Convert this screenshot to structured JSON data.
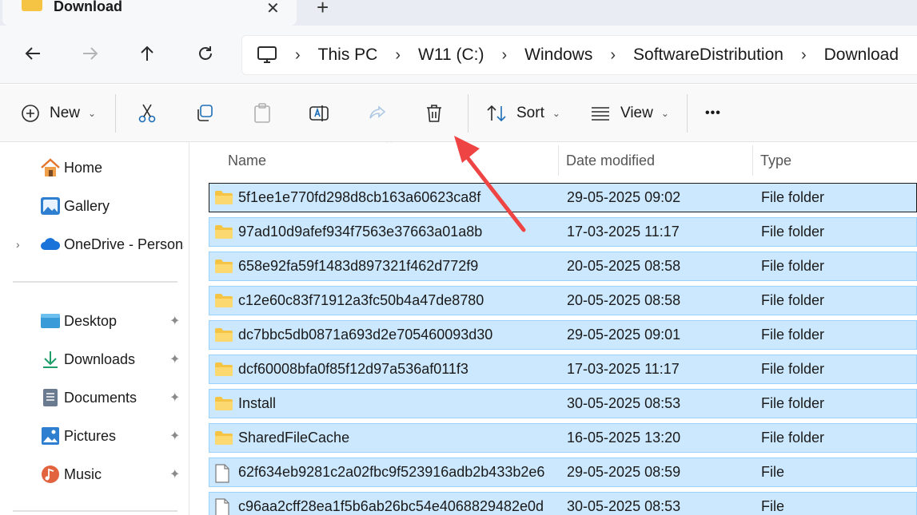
{
  "tab": {
    "title": "Download",
    "close_glyph": "✕",
    "new_glyph": "+"
  },
  "nav": {
    "back_icon": "arrow-left-icon",
    "forward_icon": "arrow-right-icon",
    "up_icon": "arrow-up-icon",
    "refresh_icon": "refresh-icon"
  },
  "breadcrumb": [
    "This PC",
    "W11 (C:)",
    "Windows",
    "SoftwareDistribution",
    "Download"
  ],
  "toolbar": {
    "new_label": "New",
    "sort_label": "Sort",
    "view_label": "View",
    "more_glyph": "•••"
  },
  "sidebar": {
    "top": [
      {
        "label": "Home",
        "icon": "home-icon"
      },
      {
        "label": "Gallery",
        "icon": "gallery-icon"
      },
      {
        "label": "OneDrive - Persona",
        "icon": "cloud-icon"
      }
    ],
    "quick": [
      {
        "label": "Desktop",
        "icon": "desktop-icon"
      },
      {
        "label": "Downloads",
        "icon": "download-icon"
      },
      {
        "label": "Documents",
        "icon": "documents-icon"
      },
      {
        "label": "Pictures",
        "icon": "pictures-icon"
      },
      {
        "label": "Music",
        "icon": "music-icon"
      }
    ],
    "expander_glyph": "›",
    "pin_glyph": "📌"
  },
  "columns": {
    "name": "Name",
    "date": "Date modified",
    "type": "Type"
  },
  "rows": [
    {
      "name": "5f1ee1e770fd298d8cb163a60623ca8f",
      "date": "29-05-2025 09:02",
      "type": "File folder",
      "kind": "folder"
    },
    {
      "name": "97ad10d9afef934f7563e37663a01a8b",
      "date": "17-03-2025 11:17",
      "type": "File folder",
      "kind": "folder"
    },
    {
      "name": "658e92fa59f1483d897321f462d772f9",
      "date": "20-05-2025 08:58",
      "type": "File folder",
      "kind": "folder"
    },
    {
      "name": "c12e60c83f71912a3fc50b4a47de8780",
      "date": "20-05-2025 08:58",
      "type": "File folder",
      "kind": "folder"
    },
    {
      "name": "dc7bbc5db0871a693d2e705460093d30",
      "date": "29-05-2025 09:01",
      "type": "File folder",
      "kind": "folder"
    },
    {
      "name": "dcf60008bfa0f85f12d97a536af011f3",
      "date": "17-03-2025 11:17",
      "type": "File folder",
      "kind": "folder"
    },
    {
      "name": "Install",
      "date": "30-05-2025 08:53",
      "type": "File folder",
      "kind": "folder"
    },
    {
      "name": "SharedFileCache",
      "date": "16-05-2025 13:20",
      "type": "File folder",
      "kind": "folder"
    },
    {
      "name": "62f634eb9281c2a02fbc9f523916adb2b433b2e6",
      "date": "29-05-2025 08:59",
      "type": "File",
      "kind": "file"
    },
    {
      "name": "c96aa2cff28ea1f5b6ab26bc54e4068829482e0d",
      "date": "30-05-2025 08:53",
      "type": "File",
      "kind": "file"
    }
  ],
  "colors": {
    "selection": "#cce8ff",
    "selection_border": "#99d1ff",
    "folder": "#f6c445",
    "annotation_arrow": "#ef4444"
  }
}
